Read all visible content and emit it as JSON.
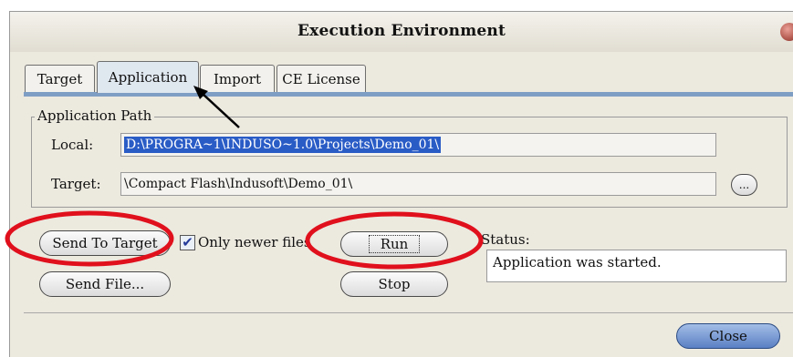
{
  "window": {
    "title": "Execution Environment"
  },
  "tabs": [
    {
      "label": "Target"
    },
    {
      "label": "Application",
      "active": true
    },
    {
      "label": "Import"
    },
    {
      "label": "CE License"
    }
  ],
  "application_path": {
    "group_label": "Application Path",
    "local_label": "Local:",
    "local_value": "D:\\PROGRA~1\\INDUSO~1.0\\Projects\\Demo_01\\",
    "target_label": "Target:",
    "target_value": "\\Compact Flash\\Indusoft\\Demo_01\\",
    "browse_label": "..."
  },
  "actions": {
    "send_to_target": "Send To Target",
    "only_newer_files": "Only newer files",
    "only_newer_checked": true,
    "send_file": "Send File...",
    "run": "Run",
    "stop": "Stop"
  },
  "status": {
    "label": "Status:",
    "text": "Application was started."
  },
  "footer": {
    "close": "Close"
  },
  "colors": {
    "annotation_red": "#e0101c",
    "selection_blue": "#2a5cc6",
    "tab_underline": "#7f9ec4"
  }
}
